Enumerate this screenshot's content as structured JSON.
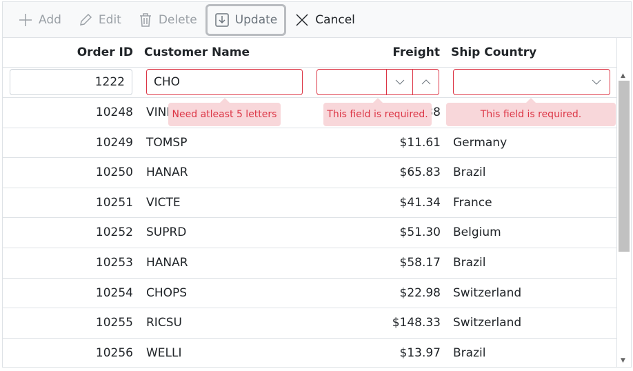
{
  "toolbar": {
    "add": "Add",
    "edit": "Edit",
    "delete": "Delete",
    "update": "Update",
    "cancel": "Cancel"
  },
  "columns": [
    "Order ID",
    "Customer Name",
    "Freight",
    "Ship Country"
  ],
  "edit_row": {
    "order_id": "1222",
    "customer_name": "CHO",
    "freight": "",
    "ship_country": ""
  },
  "validation": {
    "customer_name": "Need atleast 5 letters",
    "freight": "This field is required.",
    "ship_country": "This field is required."
  },
  "rows": [
    [
      "10248",
      "VINET",
      "$32.38",
      ""
    ],
    [
      "10249",
      "TOMSP",
      "$11.61",
      "Germany"
    ],
    [
      "10250",
      "HANAR",
      "$65.83",
      "Brazil"
    ],
    [
      "10251",
      "VICTE",
      "$41.34",
      "France"
    ],
    [
      "10252",
      "SUPRD",
      "$51.30",
      "Belgium"
    ],
    [
      "10253",
      "HANAR",
      "$58.17",
      "Brazil"
    ],
    [
      "10254",
      "CHOPS",
      "$22.98",
      "Switzerland"
    ],
    [
      "10255",
      "RICSU",
      "$148.33",
      "Switzerland"
    ],
    [
      "10256",
      "WELLI",
      "$13.97",
      "Brazil"
    ]
  ],
  "colors": {
    "error": "#dc3545",
    "error_bg": "#f8d7da"
  }
}
